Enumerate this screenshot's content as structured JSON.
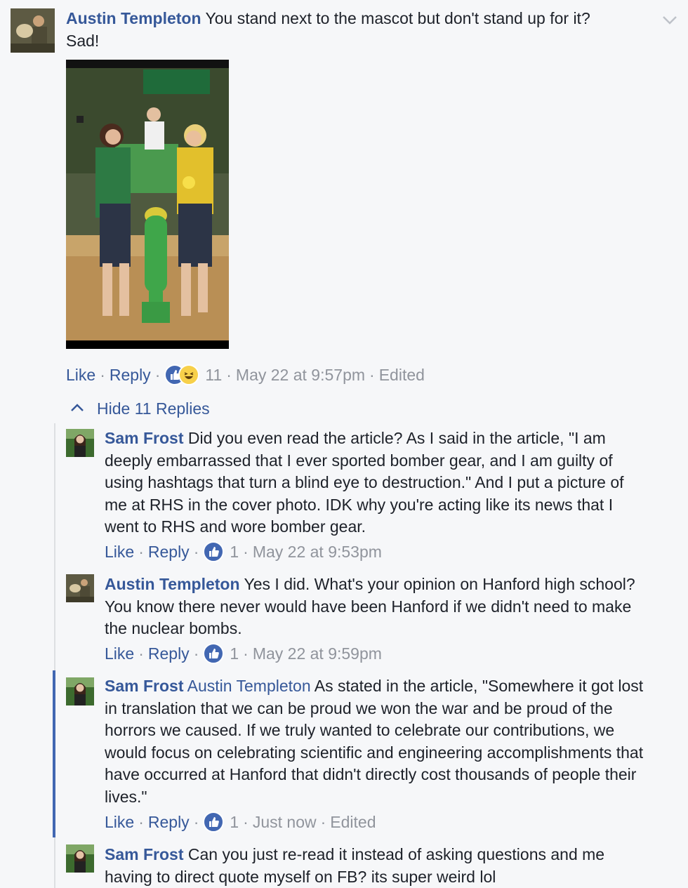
{
  "top_comment": {
    "author": "Austin Templeton",
    "text": "You stand next to the mascot but don't stand up for it? Sad!",
    "actions": {
      "like": "Like",
      "reply": "Reply",
      "reaction_count": "11",
      "time": "May 22 at 9:57pm",
      "edited": "Edited"
    }
  },
  "replies_toggle": {
    "label": "Hide 11 Replies"
  },
  "replies": [
    {
      "author": "Sam Frost",
      "text": "Did you even read the article? As I said in the article, \"I am deeply embarrassed that I ever sported bomber gear, and I am guilty of using hashtags that turn a blind eye to destruction.\" And I put a picture of me at RHS in the cover photo. IDK why you're acting like its news that I went to RHS and wore bomber gear.",
      "actions": {
        "like": "Like",
        "reply": "Reply",
        "reaction_count": "1",
        "time": "May 22 at 9:53pm"
      }
    },
    {
      "author": "Austin Templeton",
      "text": "Yes I did. What's your opinion on Hanford high school? You know there never would have been Hanford if we didn't need to make the nuclear bombs.",
      "actions": {
        "like": "Like",
        "reply": "Reply",
        "reaction_count": "1",
        "time": "May 22 at 9:59pm"
      }
    },
    {
      "author": "Sam Frost",
      "mention": "Austin Templeton",
      "text": "As stated in the article, \"Somewhere it got lost in translation that we can be proud we won the war and be proud of the horrors we caused. If we truly wanted to celebrate our contributions, we would focus on celebrating scientific and engineering accomplishments that have occurred at Hanford that didn't directly cost thousands of people their lives.\"",
      "actions": {
        "like": "Like",
        "reply": "Reply",
        "reaction_count": "1",
        "time": "Just now",
        "edited": "Edited"
      }
    },
    {
      "author": "Sam Frost",
      "text": "Can you just re-read it instead of asking questions and me having to direct quote myself on FB? its super weird lol"
    }
  ],
  "colors": {
    "link": "#365899",
    "meta": "#90949c",
    "accent_bar": "#4267b2",
    "thread_line": "#dddfe2",
    "background": "#f6f7f9"
  }
}
